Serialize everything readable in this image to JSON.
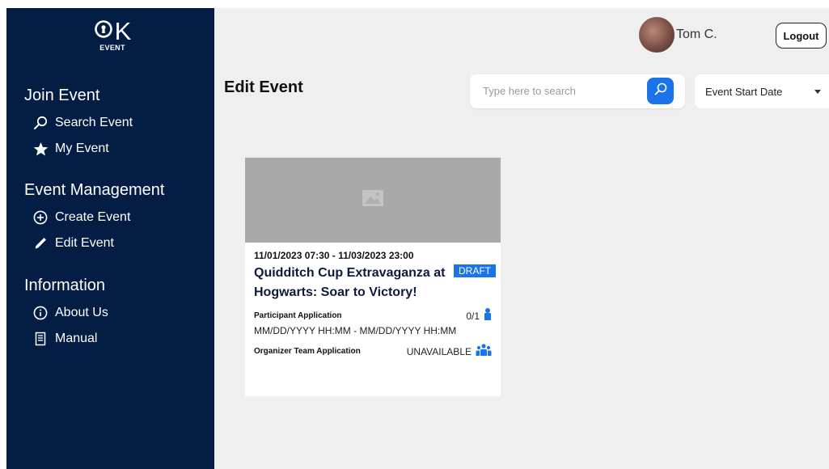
{
  "logo": {
    "mark": "K",
    "text": "EVENT"
  },
  "sidebar": {
    "sections": [
      {
        "heading": "Join Event",
        "items": [
          {
            "label": "Search Event",
            "icon": "search-icon"
          },
          {
            "label": "My Event",
            "icon": "star-icon"
          }
        ]
      },
      {
        "heading": "Event Management",
        "items": [
          {
            "label": "Create Event",
            "icon": "plus-circle-icon"
          },
          {
            "label": "Edit Event",
            "icon": "pencil-icon"
          }
        ]
      },
      {
        "heading": "Information",
        "items": [
          {
            "label": "About Us",
            "icon": "info-icon"
          },
          {
            "label": "Manual",
            "icon": "document-icon"
          }
        ]
      }
    ]
  },
  "header": {
    "user_name": "Tom C.",
    "logout_label": "Logout"
  },
  "main": {
    "page_title": "Edit Event",
    "search": {
      "placeholder": "Type here to search"
    },
    "sort": {
      "selected": "Event Start Date"
    }
  },
  "event_card": {
    "date_range": "11/01/2023 07:30 - 11/03/2023 23:00",
    "title": "Quidditch Cup Extravaganza at Hogwarts: Soar to Victory!",
    "status_badge": "DRAFT",
    "participant_label": "Participant Application",
    "participant_count": "0/1",
    "participant_range": "MM/DD/YYYY HH:MM - MM/DD/YYYY HH:MM",
    "organizer_label": "Organizer Team Application",
    "organizer_status": "UNAVAILABLE"
  },
  "colors": {
    "sidebar": "#031d45",
    "accent": "#1a73e8",
    "background": "#efefef"
  }
}
